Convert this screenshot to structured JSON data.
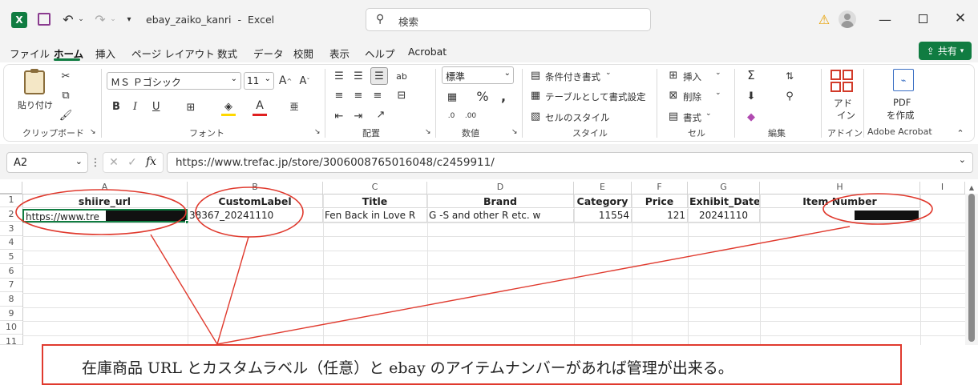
{
  "titlebar": {
    "filename": "ebay_zaiko_kanri",
    "app": "Excel",
    "sep": "-",
    "search_placeholder": "検索"
  },
  "menu": {
    "items": [
      "ファイル",
      "ホーム",
      "挿入",
      "ページ レイアウト",
      "数式",
      "データ",
      "校閲",
      "表示",
      "ヘルプ",
      "Acrobat"
    ],
    "share": "共有"
  },
  "ribbon": {
    "clipboard": {
      "paste": "貼り付け",
      "group": "クリップボード"
    },
    "font": {
      "name": "ＭＳ Ｐゴシック",
      "size": "11",
      "bold": "B",
      "italic": "I",
      "underline": "U",
      "group": "フォント"
    },
    "alignment": {
      "group": "配置"
    },
    "number": {
      "format": "標準",
      "group": "数値"
    },
    "styles": {
      "conditional": "条件付き書式",
      "table": "テーブルとして書式設定",
      "cell": "セルのスタイル",
      "group": "スタイル"
    },
    "cells": {
      "insert": "挿入",
      "delete": "削除",
      "format": "書式",
      "group": "セル"
    },
    "editing": {
      "group": "編集"
    },
    "addins": {
      "label1": "アド",
      "label2": "イン",
      "group": "アドイン"
    },
    "acrobat": {
      "label1": "PDF",
      "label2": "を作成",
      "group": "Adobe Acrobat"
    }
  },
  "formula_bar": {
    "namebox": "A2",
    "fx": "fx",
    "content": "https://www.trefac.jp/store/3006008765016048/c2459911/"
  },
  "sheet": {
    "columns": [
      "A",
      "B",
      "C",
      "D",
      "E",
      "F",
      "G",
      "H",
      "I"
    ],
    "rows": [
      "1",
      "2",
      "3",
      "4",
      "5",
      "6",
      "7",
      "8",
      "9",
      "10",
      "11"
    ],
    "headers": [
      "shiire_url",
      "CustomLabel",
      "Title",
      "Brand",
      "Category",
      "Price",
      "Exhibit_Date",
      "Item Number"
    ],
    "row2": {
      "a": "https://www.tre",
      "b": "38367_20241110",
      "c": "Fen Back in Love R",
      "d": "G -S and other R etc. w",
      "e": "11554",
      "f": "121",
      "g": "20241110"
    }
  },
  "annotation": {
    "text": "在庫商品 URL とカスタムラベル（任意）と ebay のアイテムナンバーがあれば管理が出来る。",
    "color": "#e03a2e"
  },
  "colors": {
    "excel_green": "#107c41",
    "accent_red": "#e03a2e"
  }
}
